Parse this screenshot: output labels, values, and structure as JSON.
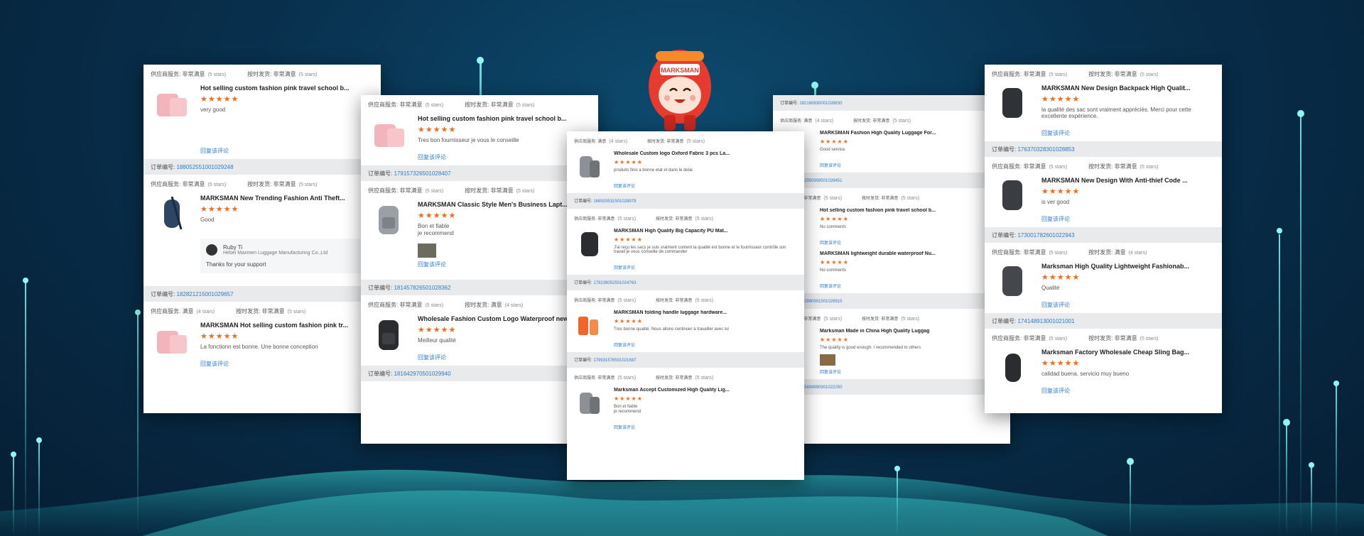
{
  "labels": {
    "provider": "供应商服务:",
    "shipping": "按时发货:",
    "view_more": "回复该评论",
    "order_no": "订单编号:"
  },
  "ratings": {
    "satisfied": "非常满意",
    "ok": "满意",
    "five": "(5 stars)",
    "four": "(4 stars)"
  },
  "cards": {
    "c1": {
      "r1": {
        "title": "Hot selling custom fashion pink travel school b...",
        "review": "very good"
      },
      "o1": "188052551001029248",
      "r2": {
        "title": "MARKSMAN New Trending Fashion Anti Theft...",
        "review": "Good",
        "reply_name": "Ruby Ti",
        "reply_company": "Hebei Maxmen Luggage Manufacturing Co.,Ltd",
        "reply_text": "Thanks for your support"
      },
      "o2": "182821215001029657",
      "r3": {
        "title": "MARKSMAN Hot selling custom fashion pink tr...",
        "review": "La fonctionn est bonne. Une bonne conception"
      }
    },
    "c2": {
      "r1": {
        "title": "Hot selling custom fashion pink travel school b...",
        "review": "Tres bon fournisseur je vous le conseille"
      },
      "o1": "179157326501028407",
      "r2": {
        "title": "MARKSMAN Classic Style Men's Business Lapt...",
        "review": "Bon et fiable",
        "review2": "je recommend"
      },
      "o2": "181457826501028362",
      "r3": {
        "title": "Wholesale Fashion Custom Logo Waterproof new Dur...",
        "review": "Meilleur qualité"
      },
      "o3": "181642970501029940"
    },
    "c3": {
      "r1": {
        "title": "Wholesale Custom logo Oxford Fabric 3 pcs La...",
        "review": "produits finis a bonne etat et dans le delai"
      },
      "o1": "168503531501028979",
      "r2": {
        "title": "MARKSMAN High Quality Big Capacity PU Mat...",
        "review": "J'ai reçu les sacs je suis vraiment content la qualité est bonne et le fournisseur contrôle son travail je vous conseille de commander"
      },
      "o2": "179239052501024763",
      "r3": {
        "title": "MARKSMAN folding handle luggage hardware...",
        "review": "Tres bonne qualité. Nous allons continuer à travailler avec lui"
      },
      "o3": "179931576501021687",
      "r4": {
        "title": "Marksman Accept Customized High Quality Lig...",
        "review": "Bon et fiable",
        "review2": "je recommend"
      }
    },
    "c4": {
      "o0": "182180830001028830",
      "r1": {
        "title": "MARKSMAN Fashion High Quality Luggage For...",
        "review": "Good service"
      },
      "o1": "182950908501028451",
      "r2": {
        "title": "Hot selling custom fashion pink travel school b...",
        "review": "No comments"
      },
      "r3": {
        "title": "MARKSMAN lightweight durable waterproof Nu...",
        "review": "No comments"
      },
      "o3": "182990901501029915",
      "r4": {
        "title": "Marksman Made in China High Quality Luggag",
        "review": "The quality is good enough. I recommended to others"
      },
      "o4": "182494990901022250"
    },
    "c5": {
      "r1": {
        "title": "MARKSMAN New Design Backpack High Qualit...",
        "review": "la qualité des sac sont vraiment appréciés. Merci pour cette excellente expérience."
      },
      "o1": "176370328301028853",
      "r2": {
        "title": "MARKSMAN New Design With Anti-thief Code ...",
        "review": "is ver good"
      },
      "o2": "173001782601022943",
      "r3": {
        "title": "Marksman High Quality Lightweight Fashionab...",
        "review": "Qualité"
      },
      "o3": "174148913001021001",
      "r4": {
        "title": "Marksman Factory Wholesale Cheap Sling Bag...",
        "review": "calidad buena, servicio muy bueno"
      }
    }
  },
  "mascot": {
    "badge": "MARKSMAN"
  },
  "icons": [
    "pink-bag-icon",
    "sling-bag-icon",
    "backpack-icon",
    "luggage-icon",
    "mascot-backpack-icon"
  ],
  "colors": {
    "accent": "#f26b1d",
    "link": "#2b7bd4",
    "glow": "#3fe6e0"
  }
}
